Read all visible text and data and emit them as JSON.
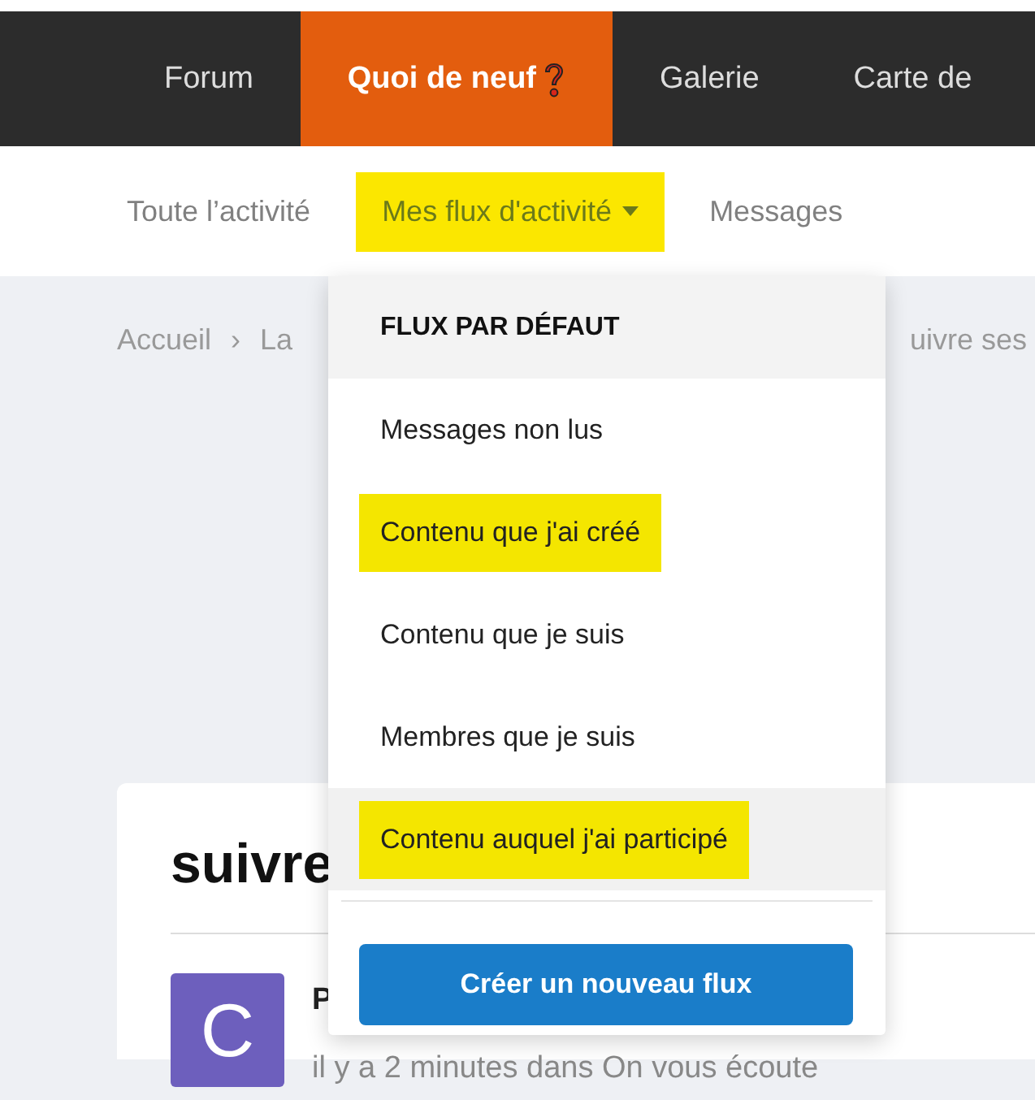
{
  "nav": {
    "items": [
      {
        "label": "Forum",
        "selected": false,
        "kind": "text"
      },
      {
        "label": "Quoi de neuf",
        "selected": true,
        "kind": "text_with_icon"
      },
      {
        "label": "Galerie",
        "selected": false,
        "kind": "text"
      },
      {
        "label": "Carte de",
        "selected": false,
        "kind": "text"
      }
    ]
  },
  "subnav": {
    "items": [
      {
        "label": "Toute l’activité",
        "highlighted": false
      },
      {
        "label": "Mes flux d'activité",
        "highlighted": true,
        "dropdown": true
      },
      {
        "label": "Messages",
        "highlighted": false
      }
    ]
  },
  "breadcrumb": {
    "items": [
      "Accueil",
      "La"
    ],
    "separator": "›",
    "trailing": "uivre ses"
  },
  "card": {
    "title": "suivre",
    "entry": {
      "avatar_letter": "C",
      "author": "P",
      "meta": "il y a 2 minutes dans On vous écoute"
    }
  },
  "menu": {
    "header": "FLUX PAR DÉFAUT",
    "items": [
      {
        "label": "Messages non lus",
        "highlighted": false,
        "hovered": false
      },
      {
        "label": "Contenu que j'ai créé",
        "highlighted": true,
        "hovered": false
      },
      {
        "label": "Contenu que je suis",
        "highlighted": false,
        "hovered": false
      },
      {
        "label": "Membres que je suis",
        "highlighted": false,
        "hovered": false
      },
      {
        "label": "Contenu auquel j'ai participé",
        "highlighted": true,
        "hovered": true
      }
    ],
    "button": "Créer un nouveau flux"
  }
}
